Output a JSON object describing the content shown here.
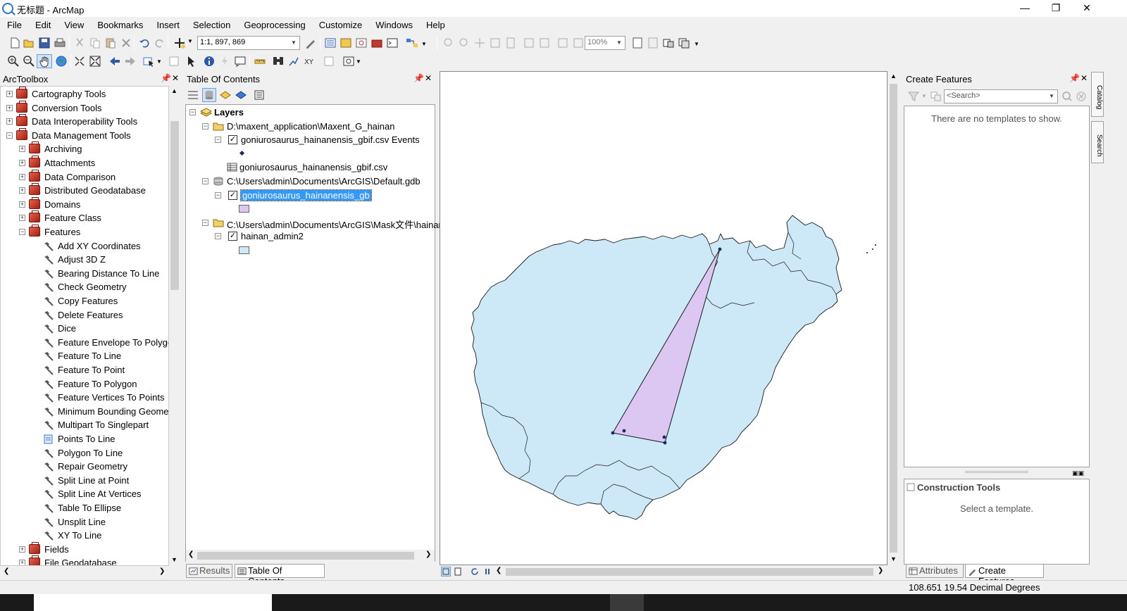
{
  "window": {
    "title": "无标题 - ArcMap"
  },
  "menu": [
    "File",
    "Edit",
    "View",
    "Bookmarks",
    "Insert",
    "Selection",
    "Geoprocessing",
    "Customize",
    "Windows",
    "Help"
  ],
  "toolbar": {
    "scale": "1:1, 897, 869",
    "zoom": "100%"
  },
  "arctoolbox": {
    "title": "ArcToolbox",
    "items": [
      {
        "label": "Cartography Tools",
        "level": 0,
        "kind": "toolbox",
        "exp": "+"
      },
      {
        "label": "Conversion Tools",
        "level": 0,
        "kind": "toolbox",
        "exp": "+"
      },
      {
        "label": "Data Interoperability Tools",
        "level": 0,
        "kind": "toolbox",
        "exp": "+"
      },
      {
        "label": "Data Management Tools",
        "level": 0,
        "kind": "toolbox",
        "exp": "−"
      },
      {
        "label": "Archiving",
        "level": 1,
        "kind": "toolset",
        "exp": "+"
      },
      {
        "label": "Attachments",
        "level": 1,
        "kind": "toolset",
        "exp": "+"
      },
      {
        "label": "Data Comparison",
        "level": 1,
        "kind": "toolset",
        "exp": "+"
      },
      {
        "label": "Distributed Geodatabase",
        "level": 1,
        "kind": "toolset",
        "exp": "+"
      },
      {
        "label": "Domains",
        "level": 1,
        "kind": "toolset",
        "exp": "+"
      },
      {
        "label": "Feature Class",
        "level": 1,
        "kind": "toolset",
        "exp": "+"
      },
      {
        "label": "Features",
        "level": 1,
        "kind": "toolset",
        "exp": "−"
      },
      {
        "label": "Add XY Coordinates",
        "level": 2,
        "kind": "tool"
      },
      {
        "label": "Adjust 3D Z",
        "level": 2,
        "kind": "tool"
      },
      {
        "label": "Bearing Distance To Line",
        "level": 2,
        "kind": "tool"
      },
      {
        "label": "Check Geometry",
        "level": 2,
        "kind": "tool"
      },
      {
        "label": "Copy Features",
        "level": 2,
        "kind": "tool"
      },
      {
        "label": "Delete Features",
        "level": 2,
        "kind": "tool"
      },
      {
        "label": "Dice",
        "level": 2,
        "kind": "tool"
      },
      {
        "label": "Feature Envelope To Polygon",
        "level": 2,
        "kind": "tool"
      },
      {
        "label": "Feature To Line",
        "level": 2,
        "kind": "tool"
      },
      {
        "label": "Feature To Point",
        "level": 2,
        "kind": "tool"
      },
      {
        "label": "Feature To Polygon",
        "level": 2,
        "kind": "tool"
      },
      {
        "label": "Feature Vertices To Points",
        "level": 2,
        "kind": "tool"
      },
      {
        "label": "Minimum Bounding Geometry",
        "level": 2,
        "kind": "tool"
      },
      {
        "label": "Multipart To Singlepart",
        "level": 2,
        "kind": "tool"
      },
      {
        "label": "Points To Line",
        "level": 2,
        "kind": "script"
      },
      {
        "label": "Polygon To Line",
        "level": 2,
        "kind": "tool"
      },
      {
        "label": "Repair Geometry",
        "level": 2,
        "kind": "tool"
      },
      {
        "label": "Split Line at Point",
        "level": 2,
        "kind": "tool"
      },
      {
        "label": "Split Line At Vertices",
        "level": 2,
        "kind": "tool"
      },
      {
        "label": "Table To Ellipse",
        "level": 2,
        "kind": "tool"
      },
      {
        "label": "Unsplit Line",
        "level": 2,
        "kind": "tool"
      },
      {
        "label": "XY To Line",
        "level": 2,
        "kind": "tool"
      },
      {
        "label": "Fields",
        "level": 1,
        "kind": "toolset",
        "exp": "+"
      },
      {
        "label": "File Geodatabase",
        "level": 1,
        "kind": "toolset",
        "exp": "+"
      }
    ]
  },
  "toc": {
    "title": "Table Of Contents",
    "rows": [
      {
        "label": "Layers",
        "indent": 0,
        "kind": "layers",
        "exp": "−",
        "bold": true
      },
      {
        "label": "D:\\maxent_application\\Maxent_G_hainan",
        "indent": 1,
        "kind": "folder",
        "exp": "−"
      },
      {
        "label": "goniurosaurus_hainanensis_gbif.csv Events",
        "indent": 2,
        "kind": "layer",
        "exp": "−",
        "check": true
      },
      {
        "label": "",
        "indent": 3,
        "kind": "point-symbol"
      },
      {
        "label": "goniurosaurus_hainanensis_gbif.csv",
        "indent": 2,
        "kind": "table"
      },
      {
        "label": "C:\\Users\\admin\\Documents\\ArcGIS\\Default.gdb",
        "indent": 1,
        "kind": "gdb",
        "exp": "−"
      },
      {
        "label": "goniurosaurus_hainanensis_gb",
        "indent": 2,
        "kind": "layer",
        "exp": "−",
        "check": true,
        "selected": true
      },
      {
        "label": "",
        "indent": 3,
        "kind": "purple-symbol"
      },
      {
        "label": "C:\\Users\\admin\\Documents\\ArcGIS\\Mask文件\\hainan",
        "indent": 1,
        "kind": "folder",
        "exp": "−"
      },
      {
        "label": "hainan_admin2",
        "indent": 2,
        "kind": "layer",
        "exp": "−",
        "check": true
      },
      {
        "label": "",
        "indent": 3,
        "kind": "blue-symbol"
      }
    ],
    "tabs": [
      "Results",
      "Table Of Contents"
    ]
  },
  "create_features": {
    "title": "Create Features",
    "search_placeholder": "<Search>",
    "empty_msg": "There are no templates to show.",
    "construction_title": "Construction Tools",
    "construction_msg": "Select a template.",
    "tabs": [
      "Attributes",
      "Create Features"
    ]
  },
  "side_tabs": [
    "Catalog",
    "Search"
  ],
  "status": {
    "coords": "108.651  19.54 Decimal Degrees"
  },
  "colors": {
    "land": "#cde8f6",
    "triangle": "#dcc6f2",
    "selection": "#3399ff"
  }
}
